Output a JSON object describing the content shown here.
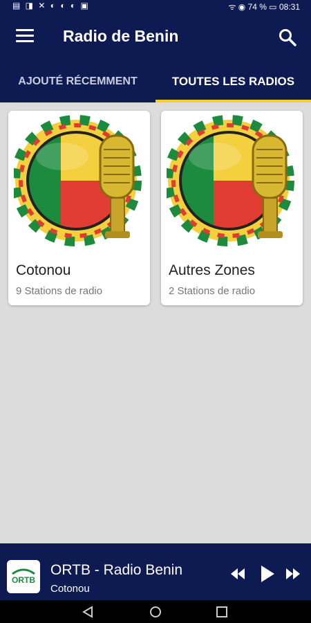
{
  "status_bar": {
    "left_icons": "▤ ◨ ✕ ◐ ◐ ◐ ▣",
    "right_text": "ᯤ ◉ 74 % ▭ 08:31"
  },
  "app_bar": {
    "title": "Radio de Benin"
  },
  "tabs": [
    {
      "label": "AJOUTÉ RÉCEMMENT",
      "active": false
    },
    {
      "label": "TOUTES LES RADIOS",
      "active": true
    }
  ],
  "cards": [
    {
      "name": "Cotonou",
      "count": "9 Stations de radio"
    },
    {
      "name": "Autres Zones",
      "count": "2 Stations de radio"
    }
  ],
  "player": {
    "logo_text": "ORTB",
    "title": "ORTB - Radio Benin",
    "subtitle": "Cotonou"
  },
  "colors": {
    "primary": "#0d1b52",
    "accent": "#f5d024",
    "flag_green": "#1c8b3d",
    "flag_yellow": "#f4d03f",
    "flag_red": "#e03c31"
  }
}
